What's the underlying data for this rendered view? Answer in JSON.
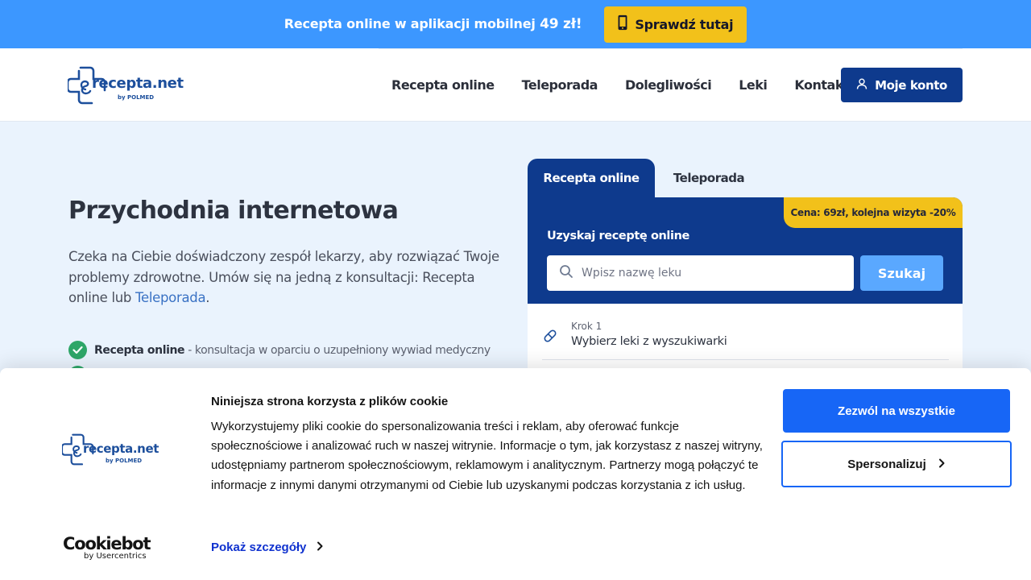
{
  "promo": {
    "text": "Recepta online w aplikacji mobilnej",
    "price": "49 zł!",
    "button_label": "Sprawdź tutaj",
    "button_icon": "smartphone-icon",
    "bg_color": "#3c97ff",
    "button_color": "#f2c11a"
  },
  "header": {
    "logo_text": "recepta.net",
    "logo_byline": "by POLMED",
    "nav": [
      "Recepta online",
      "Teleporada",
      "Dolegliwości",
      "Leki",
      "Kontakt"
    ],
    "account_label": "Moje konto",
    "account_icon": "user-icon",
    "account_color": "#0e3a8d"
  },
  "hero": {
    "title": "Przychodnia internetowa",
    "description": "Czeka na Ciebie doświadczony zespół lekarzy, aby rozwiązać Twoje problemy zdrowotne. Umów się na jedną z konsultacji: Recepta online lub ",
    "description_link": "Teleporada",
    "description_end": ".",
    "features": [
      {
        "title": "Recepta online",
        "text": " - konsultacja w oparciu o uzupełniony wywiad medyczny"
      }
    ]
  },
  "widget": {
    "tabs": [
      "Recepta online",
      "Teleporada"
    ],
    "price_badge": "Cena: 69zł, kolejna wizyta -20%",
    "heading": "Uzyskaj receptę online",
    "search_placeholder": "Wpisz nazwę leku",
    "search_value": "",
    "search_button": "Szukaj",
    "steps": [
      {
        "number": "Krok 1",
        "text": "Wybierz leki z wyszukiwarki",
        "icon": "pill-icon"
      }
    ]
  },
  "cookie": {
    "logo_text": "recepta.net",
    "logo_byline": "by POLMED",
    "title": "Niniejsza strona korzysta z plików cookie",
    "text": "Wykorzystujemy pliki cookie do spersonalizowania treści i reklam, aby oferować funkcje społecznościowe i analizować ruch w naszej witrynie. Informacje o tym, jak korzystasz z naszej witryny, udostępniamy partnerom społecznościowym, reklamowym i analitycznym. Partnerzy mogą połączyć te informacje z innymi danymi otrzymanymi od Ciebie lub uzyskanymi podczas korzystania z ich usług.",
    "details_link": "Pokaż szczegóły",
    "allow_all": "Zezwól na wszystkie",
    "customize": "Spersonalizuj",
    "cookiebot_name": "Cookiebot",
    "cookiebot_by": "by Usercentrics",
    "accent_color": "#1766f6"
  }
}
